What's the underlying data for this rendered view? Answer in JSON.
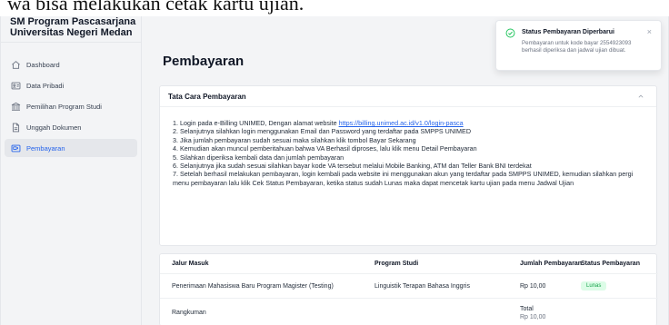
{
  "top_text": "wa bisa melakukan cetak kartu ujian.",
  "brand": {
    "line1": "SM Program Pascasarjana",
    "line2": "Universitas Negeri Medan"
  },
  "sidebar": {
    "items": [
      {
        "label": "Dashboard",
        "icon": "home-icon"
      },
      {
        "label": "Data Pribadi",
        "icon": "id-card-icon"
      },
      {
        "label": "Pemilihan Program Studi",
        "icon": "building-icon"
      },
      {
        "label": "Unggah Dokumen",
        "icon": "document-icon"
      },
      {
        "label": "Pembayaran",
        "icon": "payment-icon",
        "active": true
      }
    ]
  },
  "page": {
    "title": "Pembayaran"
  },
  "guide": {
    "title": "Tata Cara Pembayaran",
    "steps": [
      {
        "prefix": "1. Login pada e-Billing UNIMED, Dengan alamat website ",
        "link": "https://billing.unimed.ac.id/v1.0/login-pasca"
      },
      {
        "text": "2. Selanjutnya silahkan login menggunakan Email dan Password yang terdaftar pada SMPPS UNIMED"
      },
      {
        "text": "3. Jika jumlah pembayaran sudah sesuai maka silahkan klik tombol Bayar Sekarang"
      },
      {
        "text": "4. Kemudian akan muncul pemberitahuan bahwa VA Berhasil diproses, lalu klik menu Detail Pembayaran"
      },
      {
        "text": "5. Silahkan diperiksa kembali data dan jumlah pembayaran"
      },
      {
        "text": "6. Selanjutnya jika sudah sesuai silahkan bayar kode VA tersebut melalui Mobile Banking, ATM dan Teller Bank BNI terdekat"
      },
      {
        "text": "7. Setelah berhasil melakukan pembayaran, login kembali pada website ini menggunakan akun yang terdaftar pada SMPPS UNIMED, kemudian silahkan pergi menu pembayaran lalu klik Cek Status Pembayaran, ketika status sudah Lunas maka dapat mencetak kartu ujian pada menu Jadwal Ujian"
      }
    ]
  },
  "table": {
    "headers": [
      "Jalur Masuk",
      "Program Studi",
      "Jumlah Pembayaran",
      "Status Pembayaran"
    ],
    "row": {
      "jalur": "Penerimaan Mahasiswa Baru Program Magister (Testing)",
      "prodi": "Linguistik Terapan Bahasa Inggris",
      "jumlah": "Rp 10,00",
      "status": "Lunas"
    },
    "summary": {
      "label": "Rangkuman",
      "total_label": "Total",
      "total_value": "Rp 10,00"
    }
  },
  "toast": {
    "title": "Status Pembayaran Diperbarui",
    "message": "Pembayaran untuk kode bayar 2554923093 berhasil diperiksa dan jadwal ujian dibuat.",
    "close": "×"
  },
  "colors": {
    "accent": "#2563eb",
    "success": "#16a34a",
    "success_bg": "#dcfce7",
    "sidebar_bg": "#f3f4f6"
  }
}
